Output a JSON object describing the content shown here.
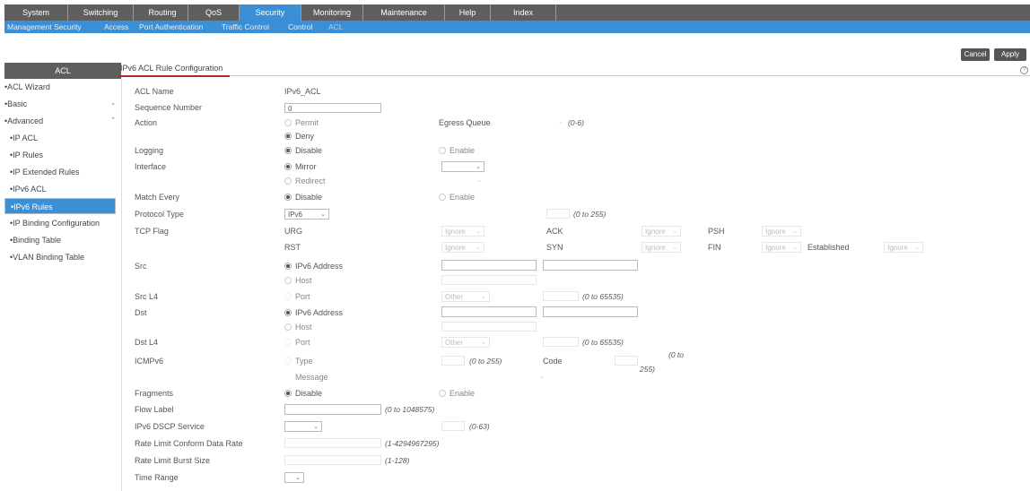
{
  "topnav": [
    "System",
    "Switching",
    "Routing",
    "QoS",
    "Security",
    "Monitoring",
    "Maintenance",
    "Help",
    "Index"
  ],
  "subnav": [
    "Management Security",
    "Access",
    "Port Authentication",
    "Traffic Control",
    "Control",
    "ACL"
  ],
  "buttons": {
    "cancel": "Cancel",
    "apply": "Apply"
  },
  "sidebar": {
    "title": "ACL",
    "items": [
      "•ACL Wizard",
      "•Basic",
      "•Advanced",
      "•IP ACL",
      "•IP Rules",
      "•IP Extended Rules",
      "•IPv6 ACL",
      "•IPv6 Rules",
      "•IP Binding Configuration",
      "•Binding Table",
      "•VLAN Binding Table"
    ]
  },
  "page_title": "IPv6 ACL Rule Configuration",
  "form": {
    "acl_name_label": "ACL Name",
    "acl_name_value": "IPv6_ACL",
    "seq_label": "Sequence Number",
    "seq_value": "0",
    "action_label": "Action",
    "permit": "Permit",
    "deny": "Deny",
    "egress_label": "Egress Queue",
    "egress_range": "(0-6)",
    "logging_label": "Logging",
    "disable": "Disable",
    "enable": "Enable",
    "interface_label": "Interface",
    "mirror": "Mirror",
    "redirect": "Redirect",
    "match_every_label": "Match Every",
    "protocol_label": "Protocol Type",
    "protocol_value": "IPv6",
    "protocol_range": "(0 to 255)",
    "tcp_flag_label": "TCP Flag",
    "urg": "URG",
    "ack": "ACK",
    "psh": "PSH",
    "rst": "RST",
    "syn": "SYN",
    "fin": "FIN",
    "established": "Established",
    "ignore": "Ignore",
    "src_label": "Src",
    "ipv6_address": "IPv6 Address",
    "host": "Host",
    "src_l4_label": "Src L4",
    "port": "Port",
    "other": "Other",
    "port_range": "(0 to 65535)",
    "dst_label": "Dst",
    "dst_l4_label": "Dst L4",
    "icmpv6_label": "ICMPv6",
    "type": "Type",
    "type_range": "(0 to 255)",
    "code": "Code",
    "code_range_1": "(0 to",
    "code_range_2": "255)",
    "message": "Message",
    "fragments_label": "Fragments",
    "flow_label_label": "Flow Label",
    "flow_range": "(0 to 1048575)",
    "dscp_label": "IPv6 DSCP Service",
    "dscp_range": "(0-63)",
    "rate_limit_label": "Rate Limit Conform Data Rate",
    "rate_range": "(1-4294967295)",
    "burst_label": "Rate Limit Burst Size",
    "burst_range": "(1-128)",
    "time_range_label": "Time Range"
  },
  "colors": {
    "nav_bg": "#5e5e5e",
    "accent": "#3a8fd6",
    "title_underline": "#a82a2a"
  }
}
